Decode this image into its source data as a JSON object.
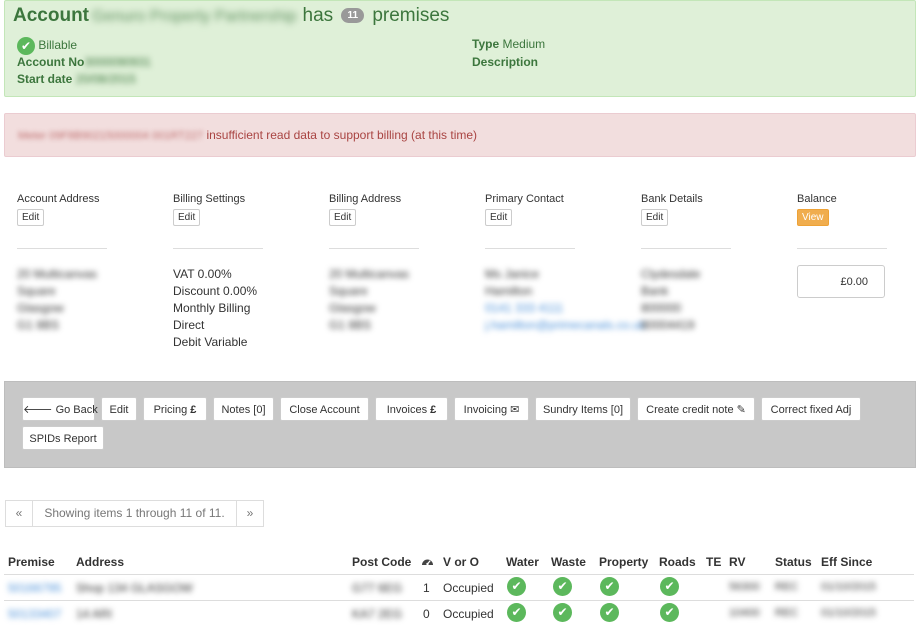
{
  "account": {
    "title_prefix": "Account",
    "name": "Genuro Property Partnership",
    "has_word": "has",
    "premises_count": "11",
    "premises_word": "premises",
    "billable_label": "Billable",
    "account_no_label": "Account No",
    "account_no_value": "3000090931",
    "start_date_label": "Start date",
    "start_date_value": "20/08/2015",
    "type_label": "Type",
    "type_value": "Medium",
    "description_label": "Description"
  },
  "alert": {
    "meter_text": "Meter 09F8B90215000004 001RT227",
    "message": "insufficient read data to support billing (at this time)"
  },
  "sections": {
    "account_address": {
      "label": "Account Address",
      "button": "Edit",
      "lines": [
        "20 Multicanvas",
        "Square",
        "Glasgow",
        "G1 8BS"
      ]
    },
    "billing_settings": {
      "label": "Billing Settings",
      "button": "Edit",
      "lines": [
        "VAT 0.00%",
        "Discount 0.00%",
        "Monthly Billing",
        "Direct",
        "Debit Variable"
      ]
    },
    "billing_address": {
      "label": "Billing Address",
      "button": "Edit",
      "lines": [
        "20 Multicanvas",
        "Square",
        "Glasgow",
        "G1 8BS"
      ]
    },
    "primary_contact": {
      "label": "Primary Contact",
      "button": "Edit",
      "lines": [
        "Ms Janice",
        "Hamilton",
        "0141 333 4111",
        "j.hamilton@primecanals.co.uk"
      ]
    },
    "bank_details": {
      "label": "Bank Details",
      "button": "Edit",
      "lines": [
        "Clydesdale",
        "Bank",
        "800000",
        "80004419"
      ]
    },
    "balance": {
      "label": "Balance",
      "button": "View",
      "value": "£0.00"
    }
  },
  "toolbar": {
    "go_back": "Go Back",
    "edit": "Edit",
    "pricing": "Pricing",
    "notes": "Notes [0]",
    "close_account": "Close Account",
    "invoices": "Invoices",
    "invoicing": "Invoicing",
    "sundry_items": "Sundry Items [0]",
    "create_credit_note": "Create credit note",
    "correct_fixed_adj": "Correct fixed Adj",
    "spids_report": "SPIDs Report"
  },
  "pager": {
    "prev": "«",
    "status": "Showing items 1 through 11 of 11.",
    "next": "»"
  },
  "table": {
    "headers": {
      "premise": "Premise",
      "address": "Address",
      "post_code": "Post Code",
      "v_or_o": "V or O",
      "water": "Water",
      "waste": "Waste",
      "property": "Property",
      "roads": "Roads",
      "te": "TE",
      "rv": "RV",
      "status": "Status",
      "eff_since": "Eff Since"
    },
    "rows": [
      {
        "premise": "50166795",
        "address": "Shop 134 GLASGOW",
        "post_code": "G77 6EG",
        "meters": "1",
        "v_or_o": "Occupied",
        "rv": "56300",
        "status": "REC",
        "eff_since": "01/10/2015"
      },
      {
        "premise": "50133407",
        "address": "14 ARI",
        "post_code": "KA7 2EG",
        "meters": "0",
        "v_or_o": "Occupied",
        "rv": "10400",
        "status": "REC",
        "eff_since": "01/10/2015"
      }
    ]
  },
  "colors": {
    "success_bg": "#dff0d8",
    "success_text": "#3c763d",
    "danger_bg": "#f2dede",
    "danger_text": "#a94442",
    "check_green": "#5cb85c",
    "warning": "#f0ad4e",
    "toolbar_bg": "#c8c8c8"
  },
  "icons": [
    "check-circle-icon",
    "arrow-left-icon",
    "pound-icon",
    "envelope-icon",
    "pencil-icon",
    "dashboard-icon"
  ]
}
